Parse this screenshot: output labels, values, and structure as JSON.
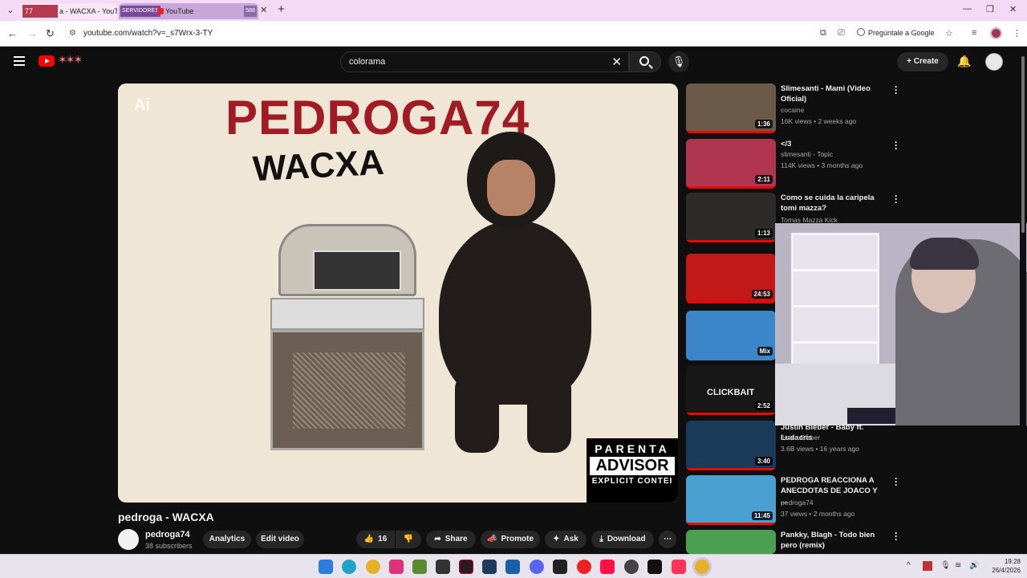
{
  "browser": {
    "tabs": [
      {
        "badge": "77",
        "title": "a - WACXA - YouTu"
      },
      {
        "badge": "SERVIDORES",
        "title": "YouTube",
        "count": "588"
      }
    ],
    "url": "youtube.com/watch?v=_s7Wrx-3-TY",
    "ask_google": "Pregúntale a Google"
  },
  "youtube": {
    "search": {
      "value": "colorama"
    },
    "create_label": "Create"
  },
  "player": {
    "watermark": "Ai",
    "artist_text": "PEDROGA74",
    "song_text": "WACXA",
    "advisory": {
      "line1": "PARENTA",
      "line2": "ADVISOR",
      "line3": "EXPLICIT CONTEI"
    }
  },
  "video": {
    "title": "pedroga - WACXA",
    "channel": "pedroga74",
    "subscribers": "38 subscribers",
    "buttons": {
      "analytics": "Analytics",
      "edit": "Edit video",
      "likes": "16",
      "share": "Share",
      "promote": "Promote",
      "ask": "Ask",
      "download": "Download"
    }
  },
  "sidebar": [
    {
      "title": "Slimesanti - Mami (Video Oficial)",
      "channel": "cocaine",
      "meta": "16K views • 2 weeks ago",
      "duration": "1:36",
      "color": "#6b5a48"
    },
    {
      "title": "</3",
      "channel": "slimesanti - Topic",
      "meta": "114K views • 3 months ago",
      "duration": "2:11",
      "color": "#b03550"
    },
    {
      "title": "Como se cuida la caripela tomi mazza?",
      "channel": "Tomas Mazza Kick",
      "meta": "",
      "duration": "1:13",
      "color": "#2d2a2a"
    },
    {
      "title": "",
      "channel": "",
      "meta": "",
      "duration": "24:53",
      "color": "#c21818"
    },
    {
      "title": "",
      "channel": "",
      "meta": "",
      "duration": "Mix",
      "color": "#3a86c9"
    },
    {
      "title": "",
      "channel": "",
      "meta": "",
      "duration": "2:52",
      "color": "#181818",
      "thumb_text": "CLICKBAIT"
    },
    {
      "title": "Justin Bieber - Baby ft. Ludacris",
      "channel": "Justin Bieber",
      "meta": "3.6B views • 16 years ago",
      "duration": "3:40",
      "color": "#1a3a5a"
    },
    {
      "title": "PEDROGA REACCIONA A ANECDOTAS DE JOACO Y ...",
      "channel": "pedroga74",
      "meta": "37 views • 2 months ago",
      "duration": "11:45",
      "color": "#4aa0d0"
    },
    {
      "title": "Pankky, Blagh - Todo bien pero (remix)",
      "channel": "",
      "meta": "",
      "duration": "",
      "color": "#4aa050"
    }
  ],
  "taskbar": {
    "time": "19:28",
    "date": "26/4/2026",
    "icons": [
      "windows",
      "edge",
      "chrome",
      "tiktok",
      "minecraft",
      "epic",
      "valorant",
      "steam",
      "discord",
      "capcut",
      "roblox",
      "music",
      "obs",
      "warp",
      "brave",
      "chrome-active"
    ]
  }
}
